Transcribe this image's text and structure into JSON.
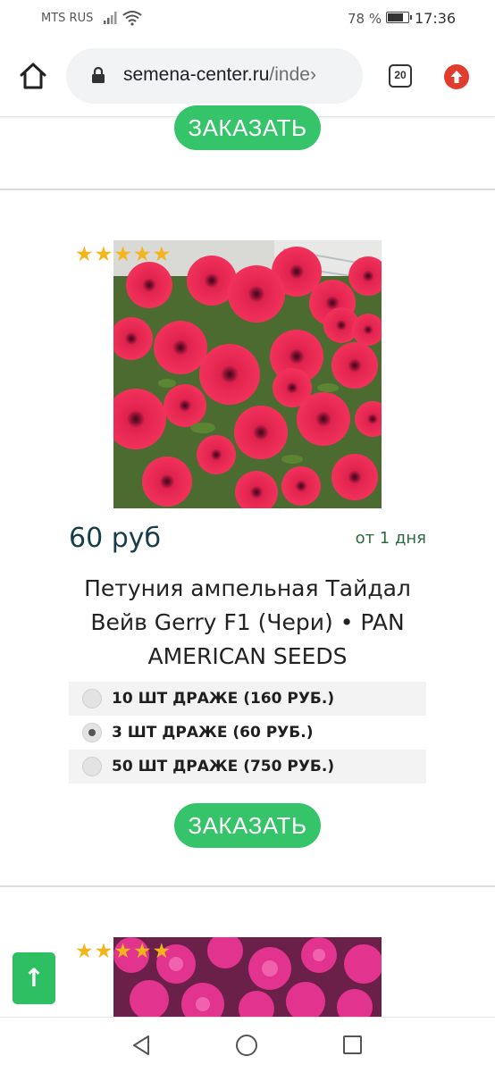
{
  "status_bar": {
    "carrier": "MTS RUS",
    "battery_percent": "78 %",
    "battery_level": 0.78,
    "time": "17:36"
  },
  "browser": {
    "url_main": "semena-center.ru",
    "url_rest": "/inde›",
    "tab_count": "20",
    "icons": [
      "home-icon",
      "lock-icon",
      "tabs-counter",
      "update-icon"
    ]
  },
  "top_order_button": {
    "label": "ЗАКАЗАТЬ"
  },
  "product": {
    "rating": 5,
    "rating_max": 5,
    "price": "60 руб",
    "delivery": "от 1 дня",
    "title": "Петуния ампельная Тайдал Вейв Gerry F1 (Чери) • PAN AMERICAN SEEDS",
    "options": [
      {
        "label": "10 ШТ ДРАЖЕ (160 РУБ.)",
        "selected": false
      },
      {
        "label": "3 ШТ ДРАЖЕ (60 РУБ.)",
        "selected": true
      },
      {
        "label": "50 ШТ ДРАЖЕ (750 РУБ.)",
        "selected": false
      }
    ],
    "order_label": "ЗАКАЗАТЬ"
  },
  "next_product": {
    "rating": 5,
    "rating_max": 5
  },
  "scroll_top": {
    "label": "↑"
  },
  "colors": {
    "order_green": "#36c46a",
    "star_gold": "#f3b51b",
    "price_text": "#173d48",
    "delivery_text": "#2a6b3a",
    "update_red": "#e23c2f"
  }
}
